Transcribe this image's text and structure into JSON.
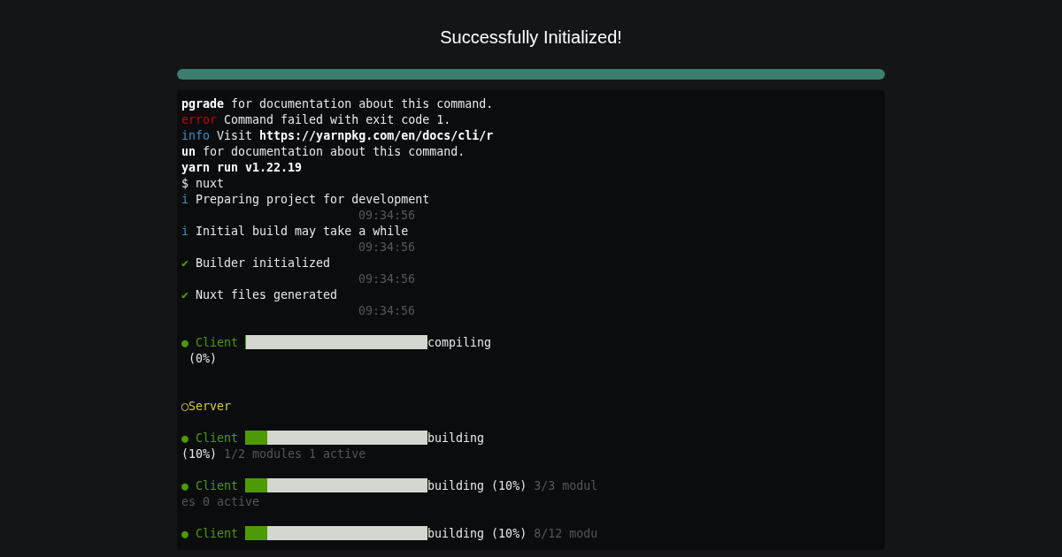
{
  "title": "Successfully Initialized!",
  "progress": {
    "level": 1
  },
  "terminal": {
    "lines": [
      {
        "kind": "log",
        "segments": [
          {
            "kind": "bold",
            "text": "pgrade"
          },
          {
            "kind": "plain",
            "text": " for documentation about this command."
          }
        ]
      },
      {
        "kind": "log",
        "segments": [
          {
            "kind": "error",
            "text": "error"
          },
          {
            "kind": "plain",
            "text": " Command failed with exit code 1."
          }
        ]
      },
      {
        "kind": "log",
        "segments": [
          {
            "kind": "info",
            "text": "info"
          },
          {
            "kind": "plain",
            "text": " Visit "
          },
          {
            "kind": "bold",
            "text": "https://yarnpkg.com/en/docs/cli/r"
          }
        ]
      },
      {
        "kind": "log",
        "segments": [
          {
            "kind": "bold",
            "text": "un"
          },
          {
            "kind": "plain",
            "text": " for documentation about this command."
          }
        ]
      },
      {
        "kind": "log",
        "segments": [
          {
            "kind": "bold",
            "text": "yarn run v1.22.19"
          }
        ]
      },
      {
        "kind": "log",
        "segments": [
          {
            "kind": "plain",
            "text": "$ nuxt"
          }
        ]
      },
      {
        "kind": "log",
        "segments": [
          {
            "kind": "info",
            "text": "i"
          },
          {
            "kind": "plain",
            "text": " Preparing project for development"
          }
        ]
      },
      {
        "kind": "time",
        "text": "09:34:56"
      },
      {
        "kind": "log",
        "segments": [
          {
            "kind": "info",
            "text": "i"
          },
          {
            "kind": "plain",
            "text": " Initial build may take a while"
          }
        ]
      },
      {
        "kind": "time",
        "text": "09:34:56"
      },
      {
        "kind": "log",
        "segments": [
          {
            "kind": "green",
            "text": "✔"
          },
          {
            "kind": "plain",
            "text": " Builder initialized"
          }
        ]
      },
      {
        "kind": "time",
        "text": "09:34:56"
      },
      {
        "kind": "log",
        "segments": [
          {
            "kind": "green",
            "text": "✔"
          },
          {
            "kind": "plain",
            "text": " Nuxt files generated"
          }
        ]
      },
      {
        "kind": "time",
        "text": "09:34:56"
      },
      {
        "kind": "blank"
      },
      {
        "kind": "log",
        "segments": [
          {
            "kind": "green",
            "text": "● Client "
          },
          {
            "kind": "bar",
            "level": 0
          },
          {
            "kind": "plain",
            "text": "compiling"
          }
        ]
      },
      {
        "kind": "log",
        "segments": [
          {
            "kind": "plain",
            "text": " (0%)"
          }
        ]
      },
      {
        "kind": "blank"
      },
      {
        "kind": "blank"
      },
      {
        "kind": "log",
        "segments": [
          {
            "kind": "yellow",
            "text": "◯Server"
          }
        ]
      },
      {
        "kind": "blank"
      },
      {
        "kind": "log",
        "segments": [
          {
            "kind": "green",
            "text": "● Client "
          },
          {
            "kind": "bar",
            "level": 0.12
          },
          {
            "kind": "plain",
            "text": "building"
          }
        ]
      },
      {
        "kind": "log",
        "segments": [
          {
            "kind": "plain",
            "text": "(10%)"
          },
          {
            "kind": "dim",
            "text": " 1/2 modules 1 active"
          }
        ]
      },
      {
        "kind": "blank"
      },
      {
        "kind": "log",
        "segments": [
          {
            "kind": "green",
            "text": "● Client "
          },
          {
            "kind": "bar",
            "level": 0.12
          },
          {
            "kind": "plain",
            "text": "building (10%)"
          },
          {
            "kind": "dim",
            "text": " 3/3 modul"
          }
        ]
      },
      {
        "kind": "log",
        "segments": [
          {
            "kind": "dim",
            "text": "es 0 active"
          }
        ]
      },
      {
        "kind": "blank"
      },
      {
        "kind": "log",
        "segments": [
          {
            "kind": "green",
            "text": "● Client "
          },
          {
            "kind": "bar",
            "level": 0.12
          },
          {
            "kind": "plain",
            "text": "building (10%)"
          },
          {
            "kind": "dim",
            "text": " 8/12 modu"
          }
        ]
      }
    ]
  }
}
